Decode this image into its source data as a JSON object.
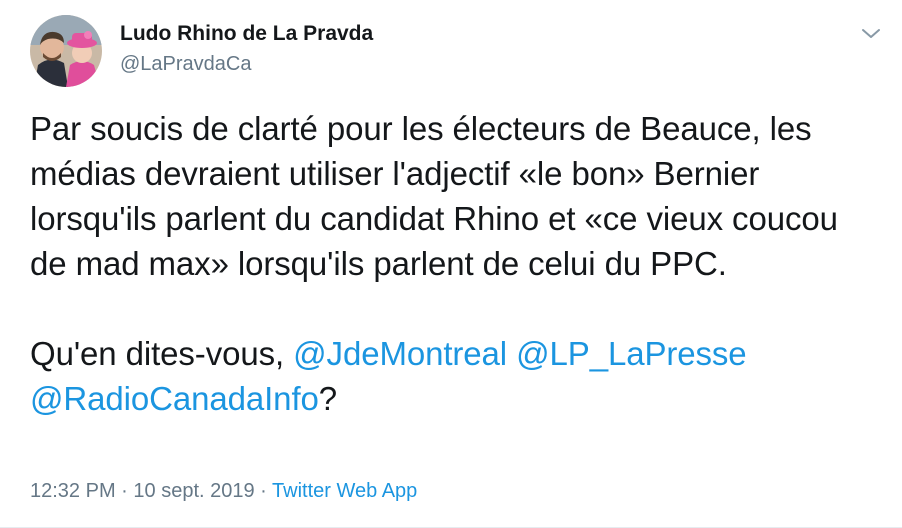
{
  "author": {
    "name": "Ludo Rhino de La Pravda",
    "handle": "@LaPravdaCa",
    "avatar_icon": "profile-photo"
  },
  "menu": {
    "icon": "chevron-down-icon"
  },
  "tweet": {
    "paragraph1": "Par soucis de clarté pour les électeurs de Beauce, les médias devraient utiliser l'adjectif «le bon» Bernier lorsqu'ils parlent du candidat Rhino et «ce vieux coucou de mad max» lorsqu'ils parlent de celui du PPC.",
    "paragraph2_prefix": "Qu'en dites-vous, ",
    "mentions": [
      "@JdeMontreal",
      "@LP_LaPresse",
      "@RadioCanadaInfo"
    ],
    "paragraph2_suffix": "?"
  },
  "meta": {
    "time": "12:32 PM",
    "separator1": " · ",
    "date": "10 sept. 2019",
    "separator2": " · ",
    "source": "Twitter Web App"
  },
  "colors": {
    "link": "#1b95e0",
    "secondary_text": "#657786",
    "primary_text": "#14171a"
  }
}
